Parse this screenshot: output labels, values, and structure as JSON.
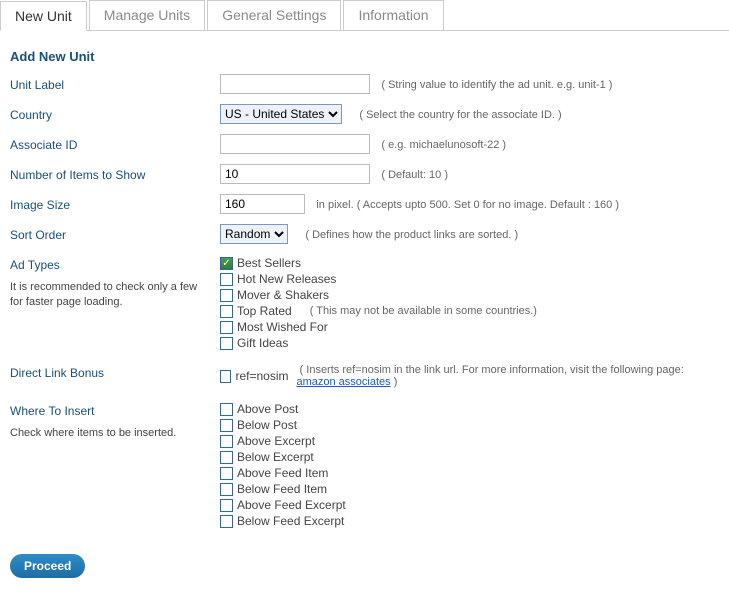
{
  "tabs": {
    "new_unit": "New Unit",
    "manage_units": "Manage Units",
    "general_settings": "General Settings",
    "information": "Information"
  },
  "heading": "Add New Unit",
  "labels": {
    "unit_label": "Unit Label",
    "country": "Country",
    "associate_id": "Associate ID",
    "num_items": "Number of Items to Show",
    "image_size": "Image Size",
    "sort_order": "Sort Order",
    "ad_types": "Ad Types",
    "ad_types_sub": "It is recommended to check only a few for faster page loading.",
    "direct_link": "Direct Link Bonus",
    "where_insert": "Where To Insert",
    "where_insert_sub": "Check where items to be inserted."
  },
  "values": {
    "unit_label": "",
    "country": "US - United States",
    "associate_id": "",
    "num_items": "10",
    "image_size": "160",
    "sort_order": "Random"
  },
  "hints": {
    "unit_label": "( String value to identify the ad unit. e.g. unit-1 )",
    "country": "( Select the country for the associate ID. )",
    "associate_id": "( e.g. michaelunosoft-22 )",
    "num_items": "( Default: 10 )",
    "image_size": "in pixel. ( Accepts upto 500. Set 0 for no image. Default : 160 )",
    "sort_order": "( Defines how the product links are sorted. )",
    "top_rated": "( This may not be available in some countries.)",
    "ref_nosim_pre": "( Inserts ref=nosim in the link url. For more information, visit the following page: ",
    "ref_nosim_post": " )"
  },
  "ad_types": {
    "best_sellers": {
      "label": "Best Sellers",
      "checked": true
    },
    "hot_new": {
      "label": "Hot New Releases",
      "checked": false
    },
    "mover": {
      "label": "Mover & Shakers",
      "checked": false
    },
    "top_rated": {
      "label": "Top Rated",
      "checked": false
    },
    "most_wished": {
      "label": "Most Wished For",
      "checked": false
    },
    "gift_ideas": {
      "label": "Gift Ideas",
      "checked": false
    }
  },
  "direct_link": {
    "ref_nosim": {
      "label": "ref=nosim",
      "checked": false
    },
    "link_text": "amazon associates"
  },
  "where_insert": {
    "above_post": "Above Post",
    "below_post": "Below Post",
    "above_excerpt": "Above Excerpt",
    "below_excerpt": "Below Excerpt",
    "above_feed_item": "Above Feed Item",
    "below_feed_item": "Below Feed Item",
    "above_feed_excerpt": "Above Feed Excerpt",
    "below_feed_excerpt": "Below Feed Excerpt"
  },
  "button": "Proceed"
}
